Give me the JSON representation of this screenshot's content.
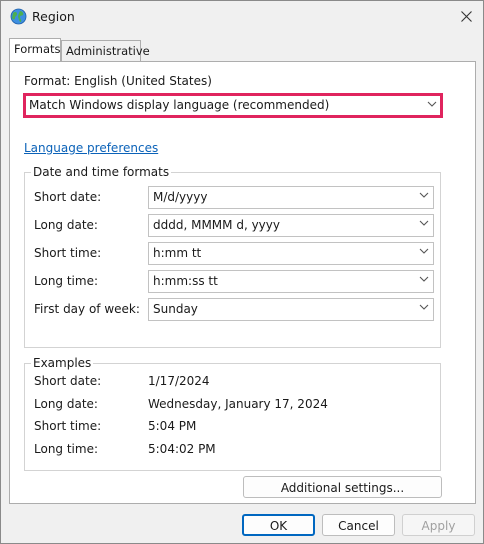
{
  "window": {
    "title": "Region",
    "app_icon": "globe-icon",
    "close_icon": "close-icon"
  },
  "tabs": [
    {
      "label": "Formats",
      "active": true
    },
    {
      "label": "Administrative",
      "active": false
    }
  ],
  "format": {
    "label": "Format: English (United States)",
    "selected": "Match Windows display language (recommended)",
    "highlight_color": "#e0245e"
  },
  "language_link": "Language preferences",
  "datetime": {
    "legend": "Date and time formats",
    "rows": [
      {
        "label": "Short date:",
        "value": "M/d/yyyy"
      },
      {
        "label": "Long date:",
        "value": "dddd, MMMM d, yyyy"
      },
      {
        "label": "Short time:",
        "value": "h:mm tt"
      },
      {
        "label": "Long time:",
        "value": "h:mm:ss tt"
      },
      {
        "label": "First day of week:",
        "value": "Sunday"
      }
    ]
  },
  "examples": {
    "legend": "Examples",
    "rows": [
      {
        "label": "Short date:",
        "value": "1/17/2024"
      },
      {
        "label": "Long date:",
        "value": "Wednesday, January 17, 2024"
      },
      {
        "label": "Short time:",
        "value": "5:04 PM"
      },
      {
        "label": "Long time:",
        "value": "5:04:02 PM"
      }
    ]
  },
  "buttons": {
    "additional": "Additional settings...",
    "ok": "OK",
    "cancel": "Cancel",
    "apply": "Apply"
  }
}
